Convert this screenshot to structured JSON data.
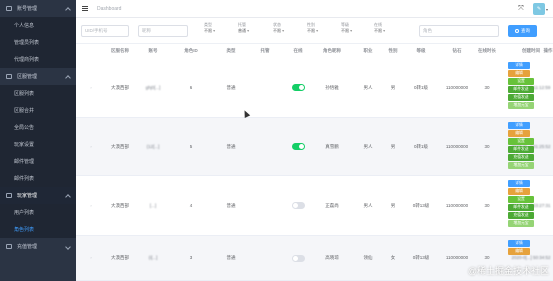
{
  "sidebar": {
    "groups": [
      {
        "label": "账号管理",
        "open": true,
        "items": [
          "个人信息",
          "管理员列表",
          "代理商列表"
        ]
      },
      {
        "label": "区服管理",
        "open": true,
        "items": [
          "区服列表",
          "区服合并",
          "全局公告",
          "玩家设置",
          "邮件管理",
          "邮件列表"
        ]
      },
      {
        "label": "玩家管理",
        "open": true,
        "items": [
          "用户列表",
          "角色列表"
        ]
      },
      {
        "label": "充值管理",
        "open": false,
        "items": []
      }
    ]
  },
  "header": {
    "breadcrumb": "Dashboard",
    "icons": [
      "expand-arrows-icon",
      "user-avatar"
    ]
  },
  "filters": {
    "input1_placeholder": "UID/手机号",
    "input2_placeholder": "昵称",
    "selects": [
      {
        "label": "类型",
        "value": "不限"
      },
      {
        "label": "托管",
        "value": "普通"
      },
      {
        "label": "状态",
        "value": "不限"
      },
      {
        "label": "性别",
        "value": "不限"
      },
      {
        "label": "等级",
        "value": "不限"
      },
      {
        "label": "在线",
        "value": "不限"
      }
    ],
    "input3_placeholder": "角色",
    "query_label": "查询"
  },
  "table": {
    "columns": [
      "",
      "区服名称",
      "账号",
      "角色ID",
      "类型",
      "托管",
      "在线",
      "角色昵称",
      "职业",
      "性别",
      "等级",
      "钻石",
      "在线时长",
      "创建时间",
      "操作"
    ],
    "rows": [
      {
        "server": "大漠西部",
        "account": "ghj0[...]",
        "role_id": "6",
        "type": "普通",
        "online": true,
        "nickname": "孙悟雅",
        "job": "男人",
        "gender": "男",
        "level": "0转1级",
        "diamond": "110000000",
        "online_time": "30",
        "created": "2020-0[...] 11:12:59"
      },
      {
        "server": "大漠西部",
        "account": "(12[...]",
        "role_id": "5",
        "type": "普通",
        "online": true,
        "nickname": "真雪鹏",
        "job": "男人",
        "gender": "男",
        "level": "0转1级",
        "diamond": "110000000",
        "online_time": "30",
        "created": "2020-0[...] 01:25:52"
      },
      {
        "server": "大漠西部",
        "account": "[...]",
        "role_id": "4",
        "type": "普通",
        "online": false,
        "nickname": "正磊尚",
        "job": "男人",
        "gender": "男",
        "level": "0转13级",
        "diamond": "110000000",
        "online_time": "30",
        "created": "2020-0[...] 23:27:31"
      },
      {
        "server": "大漠西部",
        "account": "(i[...]",
        "role_id": "3",
        "type": "普通",
        "online": false,
        "nickname": "高晓琼",
        "job": "领仙",
        "gender": "女",
        "level": "0转13级",
        "diamond": "110000000",
        "online_time": "30",
        "created": "2020-0[...] 50:34:52"
      }
    ],
    "actions": [
      "详情",
      "编辑",
      "设置",
      "邮件发送",
      "充值发送",
      "增加元宝"
    ]
  },
  "watermark": "@稀土掘金技术社区"
}
